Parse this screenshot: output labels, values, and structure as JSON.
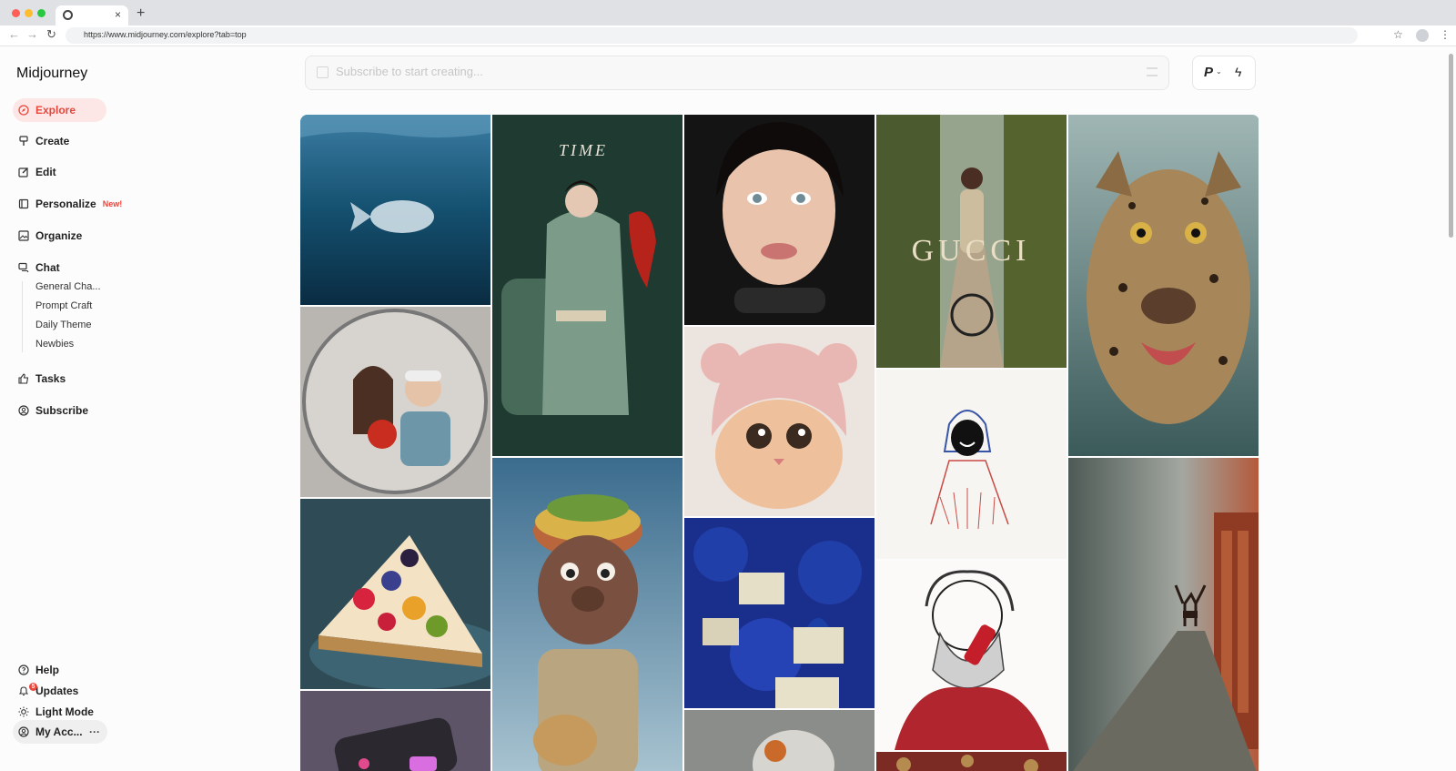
{
  "browser": {
    "url": "https://www.midjourney.com/explore?tab=top",
    "new_tab": "+",
    "close_tab": "×"
  },
  "sidebar": {
    "brand": "Midjourney",
    "items": [
      {
        "label": "Explore",
        "icon": "compass-icon",
        "active": true
      },
      {
        "label": "Create",
        "icon": "brush-icon"
      },
      {
        "label": "Edit",
        "icon": "edit-icon"
      },
      {
        "label": "Personalize",
        "icon": "personalize-icon",
        "badge": "New!"
      },
      {
        "label": "Organize",
        "icon": "image-icon"
      },
      {
        "label": "Chat",
        "icon": "chat-icon"
      },
      {
        "label": "Tasks",
        "icon": "thumbs-up-icon"
      },
      {
        "label": "Subscribe",
        "icon": "user-circle-icon"
      }
    ],
    "chat_rooms": [
      "General Cha...",
      "Prompt Craft",
      "Daily Theme",
      "Newbies"
    ],
    "bottom": {
      "help": "Help",
      "updates": "Updates",
      "updates_count": "5",
      "light_mode": "Light Mode",
      "account": "My Acc...",
      "account_more": "···"
    }
  },
  "prompt": {
    "placeholder": "Subscribe to start creating...",
    "tool_personalize": "P",
    "tool_chevron": "⌄",
    "tool_speed": "ϟ"
  },
  "gallery": {
    "time_cover_title": "TIME",
    "gucci_text": "GUCCI"
  },
  "colors": {
    "accent": "#e8473b",
    "active_bg": "#fde7e6"
  }
}
